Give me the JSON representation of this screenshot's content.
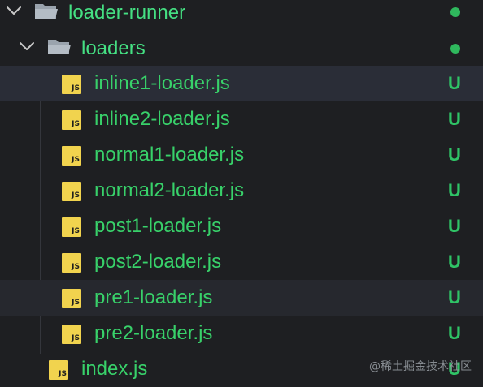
{
  "explorer": {
    "root": {
      "label": "loader-runner",
      "expanded": true
    },
    "folder": {
      "label": "loaders",
      "expanded": true
    },
    "files": [
      {
        "label": "inline1-loader.js",
        "git_status": "U",
        "icon_text": "JS"
      },
      {
        "label": "inline2-loader.js",
        "git_status": "U",
        "icon_text": "JS"
      },
      {
        "label": "normal1-loader.js",
        "git_status": "U",
        "icon_text": "JS"
      },
      {
        "label": "normal2-loader.js",
        "git_status": "U",
        "icon_text": "JS"
      },
      {
        "label": "post1-loader.js",
        "git_status": "U",
        "icon_text": "JS"
      },
      {
        "label": "post2-loader.js",
        "git_status": "U",
        "icon_text": "JS"
      },
      {
        "label": "pre1-loader.js",
        "git_status": "U",
        "icon_text": "JS"
      },
      {
        "label": "pre2-loader.js",
        "git_status": "U",
        "icon_text": "JS"
      }
    ],
    "root_file": {
      "label": "index.js",
      "git_status": "U",
      "icon_text": "JS"
    }
  },
  "watermark": "@稀土掘金技术社区",
  "colors": {
    "background": "#1e1f22",
    "untracked_green": "#38d16a",
    "js_icon_yellow": "#f1d34e",
    "modified_dot": "#2fb85d"
  },
  "icons": {
    "chevron": "chevron-down-icon",
    "folder": "folder-open-icon",
    "file": "js-file-icon"
  }
}
